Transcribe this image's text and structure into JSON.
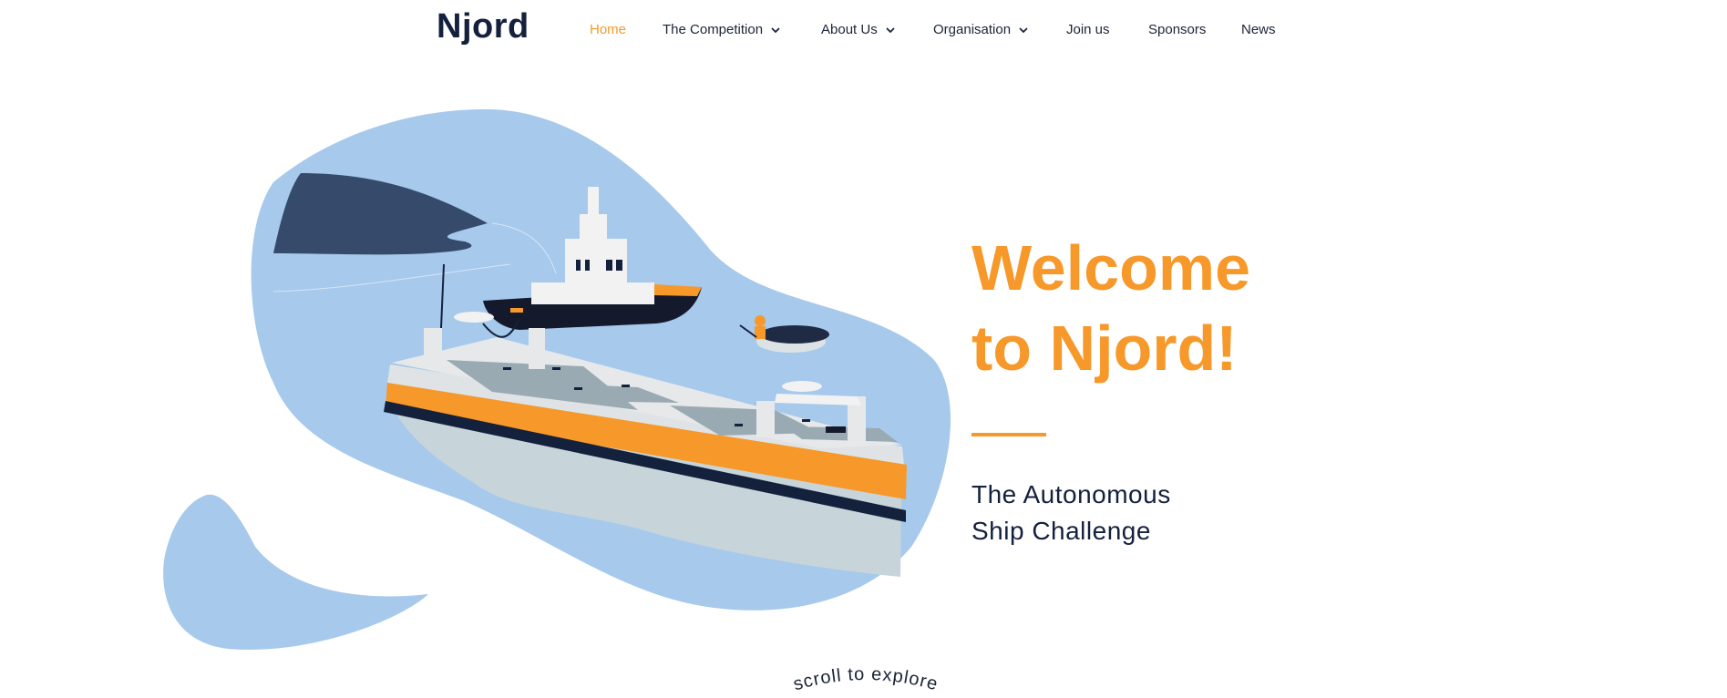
{
  "header": {
    "logo": "Njord"
  },
  "nav": {
    "items": [
      {
        "label": "Home",
        "active": true,
        "dropdown": false
      },
      {
        "label": "The Competition",
        "active": false,
        "dropdown": true
      },
      {
        "label": "About Us",
        "active": false,
        "dropdown": true
      },
      {
        "label": "Organisation",
        "active": false,
        "dropdown": true
      },
      {
        "label": "Join us",
        "active": false,
        "dropdown": false
      },
      {
        "label": "Sponsors",
        "active": false,
        "dropdown": false
      },
      {
        "label": "News",
        "active": false,
        "dropdown": false
      }
    ]
  },
  "hero": {
    "title_line1": "Welcome",
    "title_line2": "to Njord!",
    "subtitle_line1": "The Autonomous",
    "subtitle_line2": "Ship Challenge",
    "scroll_hint": "scroll to explore"
  },
  "colors": {
    "accent": "#f7982a",
    "navy": "#14213d",
    "blob": "#a6c9ec",
    "headland": "#364b6b"
  },
  "icons": {
    "dropdown": "chevron-down-icon"
  }
}
